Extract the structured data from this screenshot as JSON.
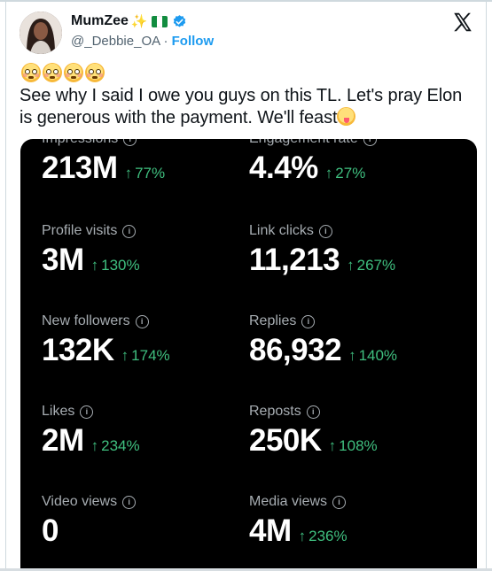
{
  "tweet": {
    "display_name": "MumZee",
    "handle": "@_Debbie_OA",
    "separator": "·",
    "follow_label": "Follow",
    "text": "See why I said I owe you guys on this TL.  Let's pray Elon is generous with the payment.  We'll feast"
  },
  "metrics": {
    "row1": [
      {
        "label": "Impressions",
        "value": "213M",
        "change": "77%"
      },
      {
        "label": "Engagement rate",
        "value": "4.4%",
        "change": "27%"
      }
    ],
    "row2": [
      {
        "label": "Profile visits",
        "value": "3M",
        "change": "130%"
      },
      {
        "label": "Link clicks",
        "value": "11,213",
        "change": "267%"
      }
    ],
    "row3": [
      {
        "label": "New followers",
        "value": "132K",
        "change": "174%"
      },
      {
        "label": "Replies",
        "value": "86,932",
        "change": "140%"
      }
    ],
    "row4": [
      {
        "label": "Likes",
        "value": "2M",
        "change": "234%"
      },
      {
        "label": "Reposts",
        "value": "250K",
        "change": "108%"
      }
    ],
    "row5": [
      {
        "label": "Video views",
        "value": "0",
        "change": ""
      },
      {
        "label": "Media views",
        "value": "4M",
        "change": "236%"
      }
    ]
  },
  "icons": [
    "verified-badge-icon",
    "x-logo-icon",
    "info-icon",
    "arrow-up-icon",
    "flushed-face-emoji",
    "yum-face-emoji",
    "sparkles-emoji",
    "nigeria-flag-emoji"
  ],
  "colors": {
    "accent": "#1d9bf0",
    "positive": "#3fbf7f",
    "card_bg": "#000000"
  }
}
